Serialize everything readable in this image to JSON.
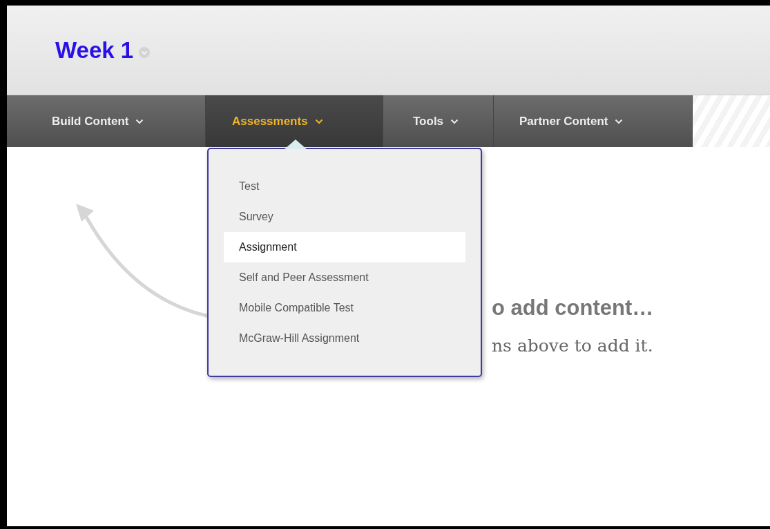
{
  "page_title": "Week 1",
  "menu": [
    {
      "label": "Build Content",
      "selected": false
    },
    {
      "label": "Assessments",
      "selected": true
    },
    {
      "label": "Tools",
      "selected": false
    },
    {
      "label": "Partner Content",
      "selected": false
    }
  ],
  "dropdown": {
    "items": [
      {
        "label": "Test",
        "selected": false
      },
      {
        "label": "Survey",
        "selected": false
      },
      {
        "label": "Assignment",
        "selected": true
      },
      {
        "label": "Self and Peer Assessment",
        "selected": false
      },
      {
        "label": "Mobile Compatible Test",
        "selected": false
      },
      {
        "label": "McGraw-Hill Assignment",
        "selected": false
      }
    ]
  },
  "empty_state": {
    "heading": "o add content…",
    "text": "ns above to add it."
  }
}
